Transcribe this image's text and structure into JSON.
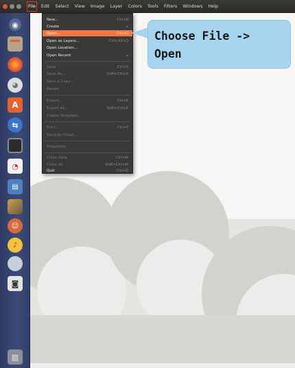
{
  "menubar": {
    "items": [
      "File",
      "Edit",
      "Select",
      "View",
      "Image",
      "Layer",
      "Colors",
      "Tools",
      "Filters",
      "Windows",
      "Help"
    ],
    "active": "File"
  },
  "file_menu": {
    "items": [
      {
        "label": "New...",
        "shortcut": "Ctrl+N",
        "state": "normal"
      },
      {
        "label": "Create",
        "shortcut": "▸",
        "state": "normal"
      },
      {
        "label": "Open...",
        "shortcut": "Ctrl+O",
        "state": "highlighted"
      },
      {
        "label": "Open as Layers...",
        "shortcut": "Ctrl+Alt+O",
        "state": "normal"
      },
      {
        "label": "Open Location...",
        "shortcut": "",
        "state": "normal"
      },
      {
        "label": "Open Recent",
        "shortcut": "▸",
        "state": "normal"
      },
      {
        "label": "Save",
        "shortcut": "Ctrl+S",
        "state": "disabled"
      },
      {
        "label": "Save As...",
        "shortcut": "Shift+Ctrl+S",
        "state": "disabled"
      },
      {
        "label": "Save a Copy...",
        "shortcut": "",
        "state": "disabled"
      },
      {
        "label": "Revert",
        "shortcut": "",
        "state": "disabled"
      },
      {
        "label": "Export...",
        "shortcut": "Ctrl+E",
        "state": "disabled"
      },
      {
        "label": "Export As...",
        "shortcut": "Shift+Ctrl+E",
        "state": "disabled"
      },
      {
        "label": "Create Template...",
        "shortcut": "",
        "state": "disabled"
      },
      {
        "label": "Print...",
        "shortcut": "Ctrl+P",
        "state": "disabled"
      },
      {
        "label": "Send by Email...",
        "shortcut": "",
        "state": "disabled"
      },
      {
        "label": "Properties",
        "shortcut": "",
        "state": "disabled"
      },
      {
        "label": "Close View",
        "shortcut": "Ctrl+W",
        "state": "disabled"
      },
      {
        "label": "Close all",
        "shortcut": "Shift+Ctrl+W",
        "state": "disabled"
      },
      {
        "label": "Quit",
        "shortcut": "Ctrl+Q",
        "state": "normal"
      }
    ]
  },
  "callout": {
    "text": "Choose File ->\nOpen",
    "background": "#a7d5f0"
  },
  "launcher": {
    "icons": [
      "dash-icon",
      "files-icon",
      "firefox-icon",
      "gimp-icon",
      "software-center-icon",
      "remote-desktop-icon",
      "terminal-icon",
      "pdf-viewer-icon",
      "document-icon",
      "image-viewer-icon",
      "app-icon",
      "audio-app-icon",
      "disk-icon",
      "camera-icon",
      "trash-icon"
    ]
  },
  "colors": {
    "highlight": "#f07746",
    "selection_outline": "#e23a2a",
    "launcher": "#3c4a78"
  }
}
